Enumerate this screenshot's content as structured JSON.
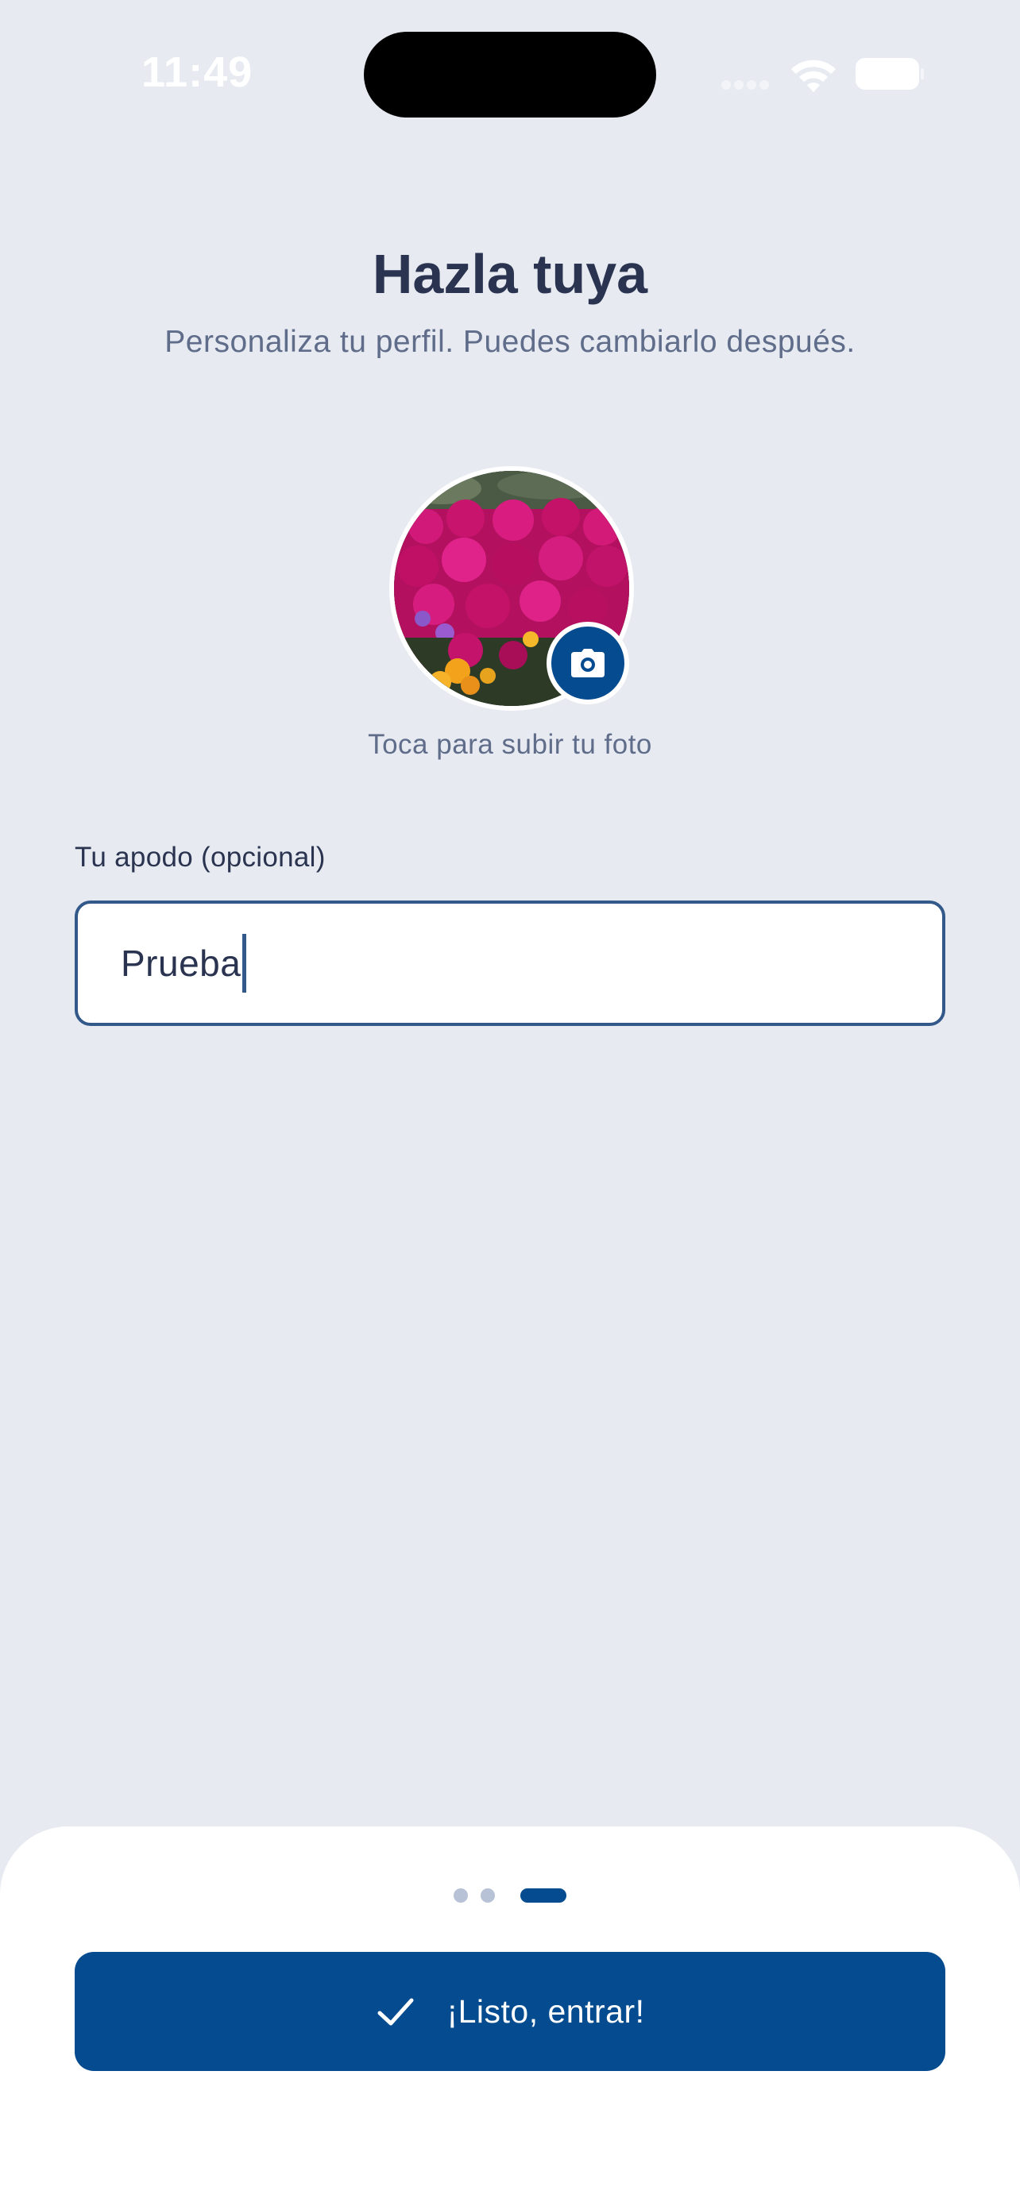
{
  "status_bar": {
    "time": "11:49"
  },
  "header": {
    "title": "Hazla tuya",
    "subtitle": "Personaliza tu perfil. Puedes cambiarlo después."
  },
  "avatar": {
    "image_alt": "Foto de perfil",
    "camera_icon": "camera-icon",
    "upload_hint": "Toca para subir tu foto"
  },
  "nickname": {
    "label": "Tu apodo (opcional)",
    "value": "Prueba"
  },
  "pager": {
    "total": 3,
    "active_index": 2
  },
  "submit": {
    "icon": "check-icon",
    "label": "¡Listo, entrar!"
  },
  "colors": {
    "background": "#e7ebf1",
    "accent": "#054b8f",
    "title": "#2a3450",
    "muted": "#5f6c8a",
    "input_border": "#33598b"
  }
}
